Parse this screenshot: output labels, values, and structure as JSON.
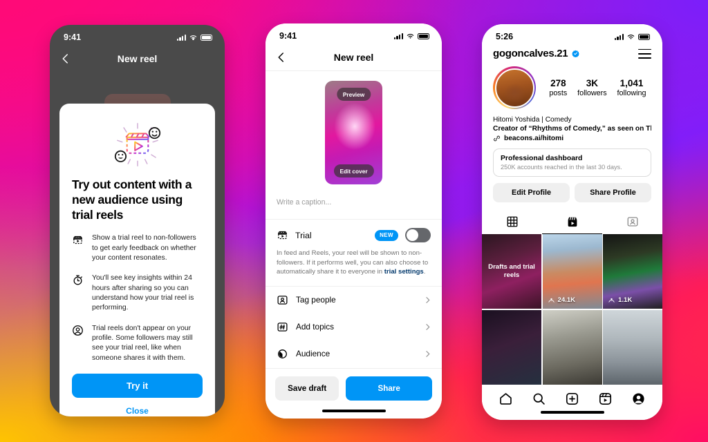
{
  "background": {
    "gradient_colors": [
      "#ff0a8c",
      "#c70fc2",
      "#8a1bf7",
      "#ff2a4d",
      "#ff8a00",
      "#ffc400"
    ]
  },
  "accent": {
    "blue": "#0095f6",
    "dark_blue": "#00376b",
    "grey": "#efefef"
  },
  "phone1": {
    "status": {
      "time": "9:41"
    },
    "nav": {
      "title": "New reel",
      "back_icon": "chevron-left-icon"
    },
    "modal": {
      "hero_icon": "trial-reel-illustration",
      "title": "Try out content with a new audience using trial reels",
      "features": [
        {
          "icon": "trial-reel-icon",
          "text": "Show a trial reel to non-followers to get early feedback on whether your content resonates."
        },
        {
          "icon": "stopwatch-icon",
          "text": "You'll see key insights within 24 hours after sharing so you can understand how your trial reel is performing."
        },
        {
          "icon": "person-circle-icon",
          "text": "Trial reels don't appear on your profile. Some followers may still see your trial reel, like when someone shares it with them."
        }
      ],
      "primary_button": "Try it",
      "secondary_button": "Close"
    }
  },
  "phone2": {
    "status": {
      "time": "9:41"
    },
    "nav": {
      "title": "New reel",
      "back_icon": "chevron-left-icon"
    },
    "cover": {
      "preview_label": "Preview",
      "edit_label": "Edit cover"
    },
    "caption_placeholder": "Write a caption...",
    "trial": {
      "icon": "trial-reel-icon",
      "label": "Trial",
      "badge": "NEW",
      "toggle_state": "off",
      "description_before": "In feed and Reels, your reel will be shown to non-followers. If it performs well, you can also choose to automatically share it to everyone in ",
      "description_link": "trial settings",
      "description_after": "."
    },
    "options": [
      {
        "icon": "tag-people-icon",
        "label": "Tag people"
      },
      {
        "icon": "hashtag-icon",
        "label": "Add topics"
      },
      {
        "icon": "audience-icon",
        "label": "Audience"
      }
    ],
    "footer": {
      "save_draft": "Save draft",
      "share": "Share"
    }
  },
  "phone3": {
    "status": {
      "time": "5:26"
    },
    "header": {
      "username": "gogoncalves.21",
      "verified_icon": "verified-badge-icon",
      "menu_icon": "hamburger-menu-icon"
    },
    "stats": [
      {
        "num": "278",
        "label": "posts"
      },
      {
        "num": "3K",
        "label": "followers"
      },
      {
        "num": "1,041",
        "label": "following"
      }
    ],
    "bio": {
      "name": "Hitomi Yoshida | Comedy",
      "description": "Creator of “Rhythms of Comedy,” as seen on The T",
      "link": "beacons.ai/hitomi",
      "link_icon": "link-icon"
    },
    "dashboard": {
      "title": "Professional dashboard",
      "subtitle": "250K accounts reached in the last 30 days."
    },
    "buttons": {
      "edit_profile": "Edit Profile",
      "share_profile": "Share Profile"
    },
    "tabs": [
      {
        "icon": "grid-icon",
        "active": false
      },
      {
        "icon": "reels-icon",
        "active": true
      },
      {
        "icon": "tagged-icon",
        "active": false
      }
    ],
    "grid": [
      {
        "style": "ph-a",
        "overlay": "Drafts and trial reels",
        "views": null
      },
      {
        "style": "ph-b",
        "overlay": null,
        "views": "24.1K"
      },
      {
        "style": "ph-c",
        "overlay": null,
        "views": "1.1K"
      },
      {
        "style": "ph-d",
        "overlay": null,
        "views": null
      },
      {
        "style": "ph-e",
        "overlay": null,
        "views": null
      },
      {
        "style": "ph-f",
        "overlay": null,
        "views": null
      }
    ],
    "nav": [
      {
        "icon": "home-icon"
      },
      {
        "icon": "search-icon"
      },
      {
        "icon": "create-plus-icon"
      },
      {
        "icon": "reels-icon"
      },
      {
        "icon": "profile-avatar-icon"
      }
    ]
  }
}
